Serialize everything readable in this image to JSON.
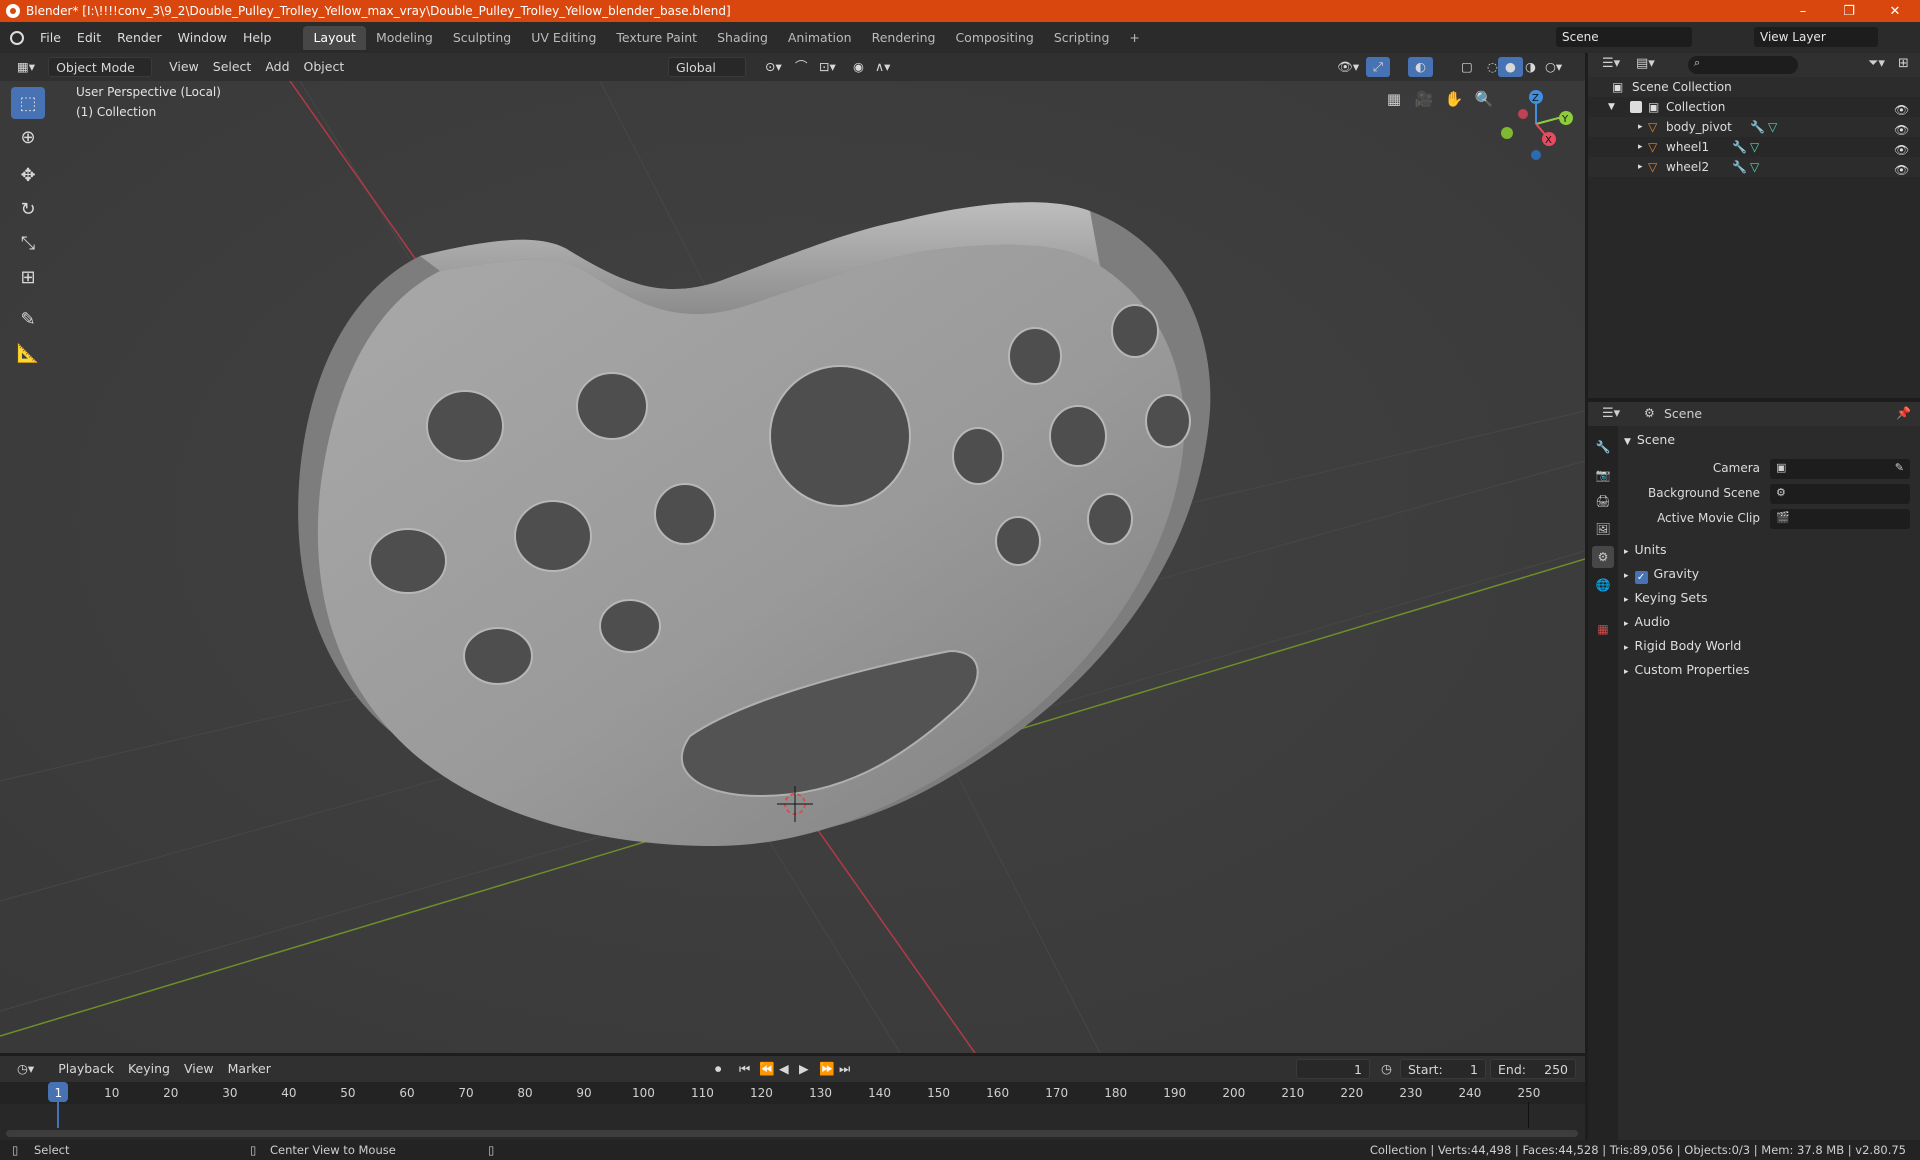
{
  "window": {
    "title": "Blender* [I:\\!!!!conv_3\\9_2\\Double_Pulley_Trolley_Yellow_max_vray\\Double_Pulley_Trolley_Yellow_blender_base.blend]",
    "minimize": "–",
    "maximize": "❐",
    "close": "✕"
  },
  "menubar": {
    "items": [
      "File",
      "Edit",
      "Render",
      "Window",
      "Help"
    ],
    "tabs": [
      "Layout",
      "Modeling",
      "Sculpting",
      "UV Editing",
      "Texture Paint",
      "Shading",
      "Animation",
      "Rendering",
      "Compositing",
      "Scripting"
    ],
    "active_tab": "Layout",
    "add_tab": "+",
    "scene_name": "Scene",
    "view_layer_name": "View Layer"
  },
  "viewport_header": {
    "mode": "Object Mode",
    "menus": [
      "View",
      "Select",
      "Add",
      "Object"
    ],
    "orientation": "Global"
  },
  "viewport": {
    "overlay_line1": "User Perspective (Local)",
    "overlay_line2": "(1) Collection",
    "gizmo": {
      "z": "Z",
      "y": "Y",
      "x": "X"
    }
  },
  "outliner": {
    "root": "Scene Collection",
    "collection": "Collection",
    "objects": [
      "body_pivot",
      "wheel1",
      "wheel2"
    ]
  },
  "properties": {
    "header_title": "Scene",
    "section": "Scene",
    "camera_label": "Camera",
    "background_scene_label": "Background Scene",
    "active_movie_clip_label": "Active Movie Clip",
    "panels": [
      "Units",
      "Gravity",
      "Keying Sets",
      "Audio",
      "Rigid Body World",
      "Custom Properties"
    ],
    "gravity_checked": true
  },
  "timeline": {
    "menus": [
      "Playback",
      "Keying",
      "View",
      "Marker"
    ],
    "current_frame": "1",
    "start_label": "Start:",
    "start_value": "1",
    "end_label": "End:",
    "end_value": "250",
    "ticks": [
      "1",
      "10",
      "20",
      "30",
      "40",
      "50",
      "60",
      "70",
      "80",
      "90",
      "100",
      "110",
      "120",
      "130",
      "140",
      "150",
      "160",
      "170",
      "180",
      "190",
      "200",
      "210",
      "220",
      "230",
      "240",
      "250"
    ]
  },
  "statusbar": {
    "left_action": "Select",
    "middle_action": "Center View to Mouse",
    "stats": "Collection | Verts:44,498 | Faces:44,528 | Tris:89,056 | Objects:0/3 | Mem: 37.8 MB | v2.80.75"
  },
  "colors": {
    "title_bar": "#d9470f",
    "accent": "#4772b3",
    "x_axis": "#e84a5f",
    "y_axis": "#8fcc3d",
    "z_axis": "#3f8fe0"
  }
}
